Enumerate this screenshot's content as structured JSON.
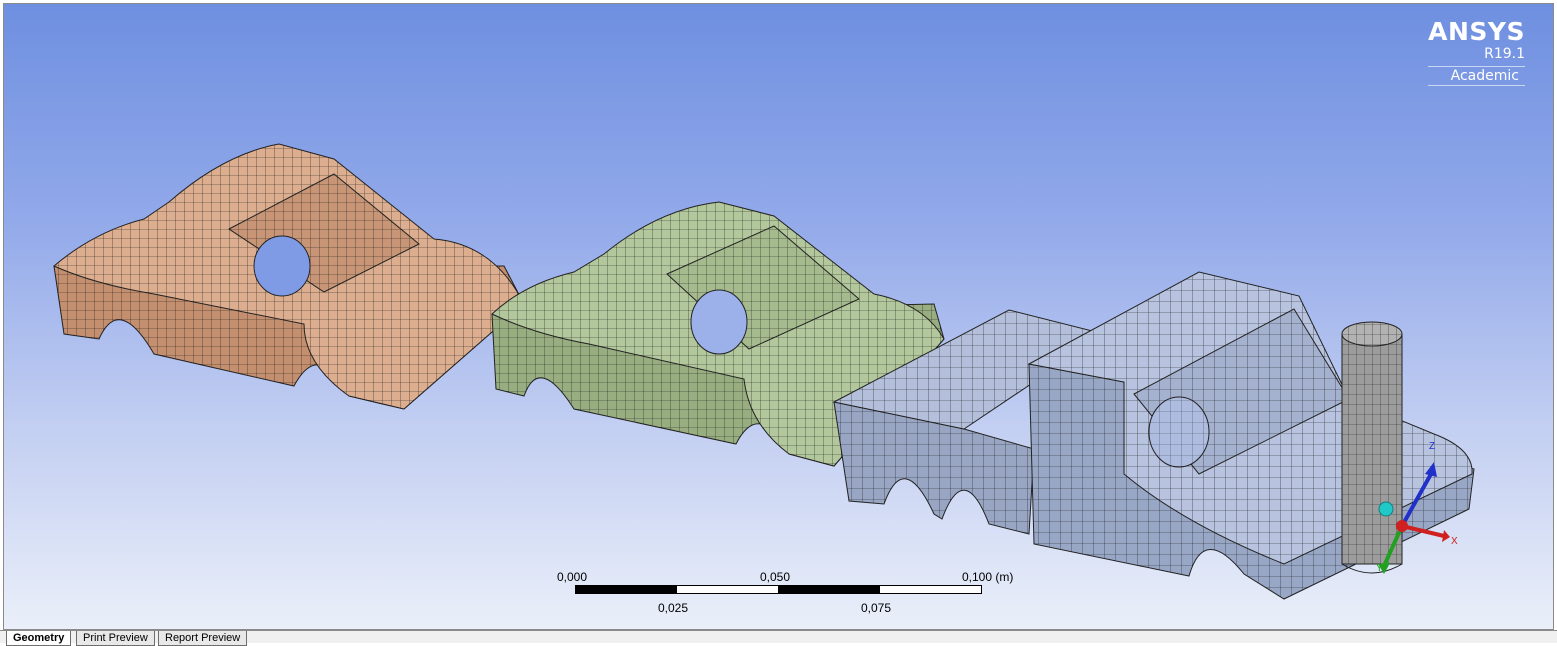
{
  "logo": {
    "brand": "ANSYS",
    "version": "R19.1",
    "edition": "Academic"
  },
  "scale": {
    "top_labels": [
      "0,000",
      "0,050",
      "0,100 (m)"
    ],
    "bottom_labels": [
      "0,025",
      "0,075"
    ]
  },
  "tabs": [
    "Geometry",
    "Print Preview",
    "Report Preview"
  ],
  "colors": {
    "body1": "#d5a585",
    "body2": "#a9c08f",
    "body3": "#aab7d2",
    "cylinder": "#a6a6a6",
    "axis_x": "#d02020",
    "axis_y": "#22a022",
    "axis_z": "#2030c8",
    "origin": "#20c8c8"
  },
  "triad": {
    "x_label": "X",
    "y_label": "Y",
    "z_label": "Z"
  }
}
